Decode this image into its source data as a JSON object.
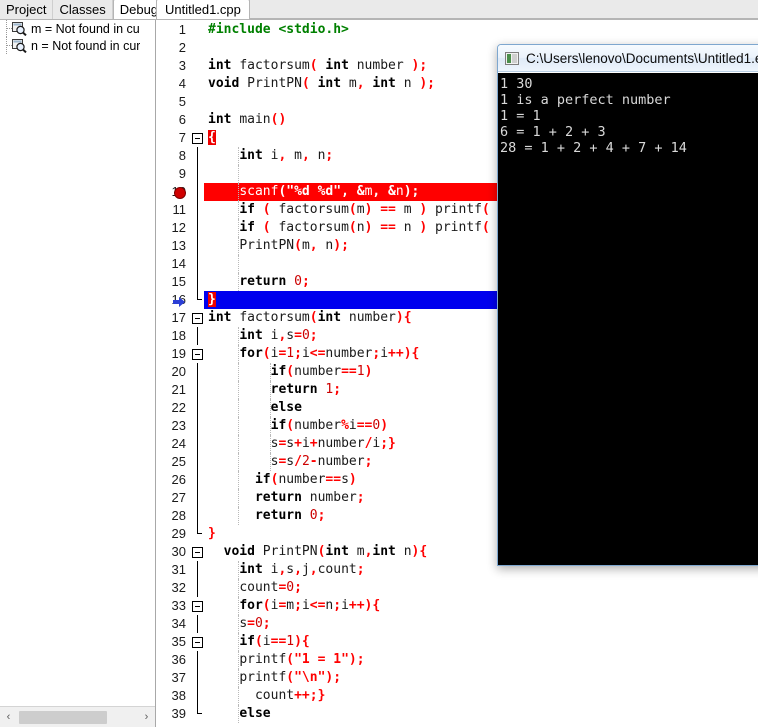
{
  "left_panel": {
    "tabs": [
      {
        "label": "Project",
        "active": false
      },
      {
        "label": "Classes",
        "active": false
      },
      {
        "label": "Debug",
        "active": true
      }
    ],
    "watches": [
      {
        "icon": "watch-magnifier-icon",
        "label": "m = Not found in cu"
      },
      {
        "icon": "watch-magnifier-icon",
        "label": "n = Not found in cur"
      }
    ],
    "scrollbar": {
      "left_arrow": "‹",
      "right_arrow": "›"
    }
  },
  "editor": {
    "tabs": [
      {
        "label": "Untitled1.cpp",
        "active": true
      }
    ],
    "lines": [
      {
        "n": "1",
        "indent": 0,
        "fold": false,
        "text": "#include <stdio.h>"
      },
      {
        "n": "2",
        "indent": 0,
        "fold": false,
        "text": ""
      },
      {
        "n": "3",
        "indent": 0,
        "fold": false,
        "text": "int factorsum( int number );"
      },
      {
        "n": "4",
        "indent": 0,
        "fold": false,
        "text": "void PrintPN( int m, int n );"
      },
      {
        "n": "5",
        "indent": 0,
        "fold": false,
        "text": ""
      },
      {
        "n": "6",
        "indent": 0,
        "fold": false,
        "text": "int main()"
      },
      {
        "n": "7",
        "indent": 0,
        "fold": true,
        "text": "{"
      },
      {
        "n": "8",
        "indent": 1,
        "fold": false,
        "text": "    int i, m, n;"
      },
      {
        "n": "9",
        "indent": 1,
        "fold": false,
        "text": ""
      },
      {
        "n": "10",
        "indent": 1,
        "fold": false,
        "text": "    scanf(\"%d %d\", &m, &n);",
        "highlight": "breakpoint",
        "marker": "breakpoint-dot"
      },
      {
        "n": "11",
        "indent": 1,
        "fold": false,
        "text": "    if ( factorsum(m) == m ) printf("
      },
      {
        "n": "12",
        "indent": 1,
        "fold": false,
        "text": "    if ( factorsum(n) == n ) printf("
      },
      {
        "n": "13",
        "indent": 1,
        "fold": false,
        "text": "    PrintPN(m, n);"
      },
      {
        "n": "14",
        "indent": 1,
        "fold": false,
        "text": ""
      },
      {
        "n": "15",
        "indent": 1,
        "fold": false,
        "text": "    return 0;"
      },
      {
        "n": "16",
        "indent": 0,
        "fold": false,
        "text": "}",
        "highlight": "current-line",
        "marker": "execution-arrow"
      },
      {
        "n": "17",
        "indent": 0,
        "fold": true,
        "text": "int factorsum(int number){"
      },
      {
        "n": "18",
        "indent": 1,
        "fold": false,
        "text": "    int i,s=0;"
      },
      {
        "n": "19",
        "indent": 1,
        "fold": true,
        "text": "    for(i=1;i<=number;i++){"
      },
      {
        "n": "20",
        "indent": 2,
        "fold": false,
        "text": "        if(number==1)"
      },
      {
        "n": "21",
        "indent": 2,
        "fold": false,
        "text": "        return 1;"
      },
      {
        "n": "22",
        "indent": 2,
        "fold": false,
        "text": "        else"
      },
      {
        "n": "23",
        "indent": 2,
        "fold": false,
        "text": "        if(number%i==0)"
      },
      {
        "n": "24",
        "indent": 2,
        "fold": false,
        "text": "        s=s+i+number/i;}"
      },
      {
        "n": "25",
        "indent": 2,
        "fold": false,
        "text": "        s=s/2-number;"
      },
      {
        "n": "26",
        "indent": 1,
        "fold": false,
        "text": "      if(number==s)"
      },
      {
        "n": "27",
        "indent": 1,
        "fold": false,
        "text": "      return number;"
      },
      {
        "n": "28",
        "indent": 1,
        "fold": false,
        "text": "      return 0;"
      },
      {
        "n": "29",
        "indent": 0,
        "fold": false,
        "text": "}"
      },
      {
        "n": "30",
        "indent": 0,
        "fold": true,
        "text": "  void PrintPN(int m,int n){"
      },
      {
        "n": "31",
        "indent": 1,
        "fold": false,
        "text": "    int i,s,j,count;"
      },
      {
        "n": "32",
        "indent": 1,
        "fold": false,
        "text": "    count=0;"
      },
      {
        "n": "33",
        "indent": 1,
        "fold": true,
        "text": "    for(i=m;i<=n;i++){"
      },
      {
        "n": "34",
        "indent": 1,
        "fold": false,
        "text": "    s=0;"
      },
      {
        "n": "35",
        "indent": 1,
        "fold": true,
        "text": "    if(i==1){"
      },
      {
        "n": "36",
        "indent": 1,
        "fold": false,
        "text": "    printf(\"1 = 1\");"
      },
      {
        "n": "37",
        "indent": 1,
        "fold": false,
        "text": "    printf(\"\\n\");"
      },
      {
        "n": "38",
        "indent": 1,
        "fold": false,
        "text": "      count++;}"
      },
      {
        "n": "39",
        "indent": 1,
        "fold": false,
        "text": "    else"
      }
    ]
  },
  "console": {
    "title": "C:\\Users\\lenovo\\Documents\\Untitled1.e",
    "icon": "console-app-icon",
    "output": "1 30\n1 is a perfect number\n1 = 1\n6 = 1 + 2 + 3\n28 = 1 + 2 + 4 + 7 + 14"
  },
  "colors": {
    "breakpoint_red": "#ff0000",
    "current_line_blue": "#0000ee",
    "keyword": "#000000",
    "string": "#ff0000",
    "preprocessor": "#008000",
    "punctuation": "#ff0000"
  }
}
